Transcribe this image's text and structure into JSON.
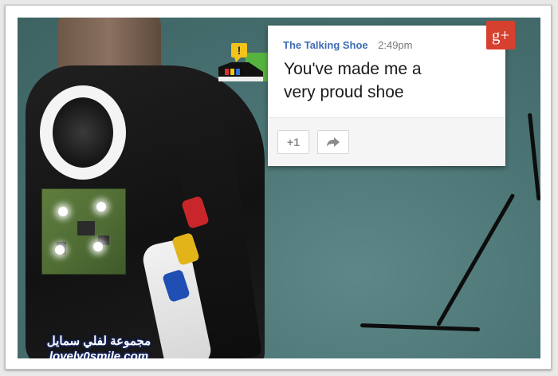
{
  "notification": {
    "author": "The Talking Shoe",
    "time": "2:49pm",
    "message": "You've made me a very proud shoe",
    "plus_one_label": "+1",
    "share_icon": "share-arrow-icon"
  },
  "badge": {
    "label": "g+",
    "color": "#d6402f"
  },
  "avatar": {
    "icon": "talking-shoe-avatar-icon",
    "alert_glyph": "!"
  },
  "watermark": {
    "arabic_text": "مجموعة لفلي سمايل",
    "site": "lovely0smile.com"
  },
  "colors": {
    "author_link": "#3e6db7",
    "stripe_red": "#c9262b",
    "stripe_yellow": "#e3b41a",
    "stripe_blue": "#1f4fb3"
  }
}
